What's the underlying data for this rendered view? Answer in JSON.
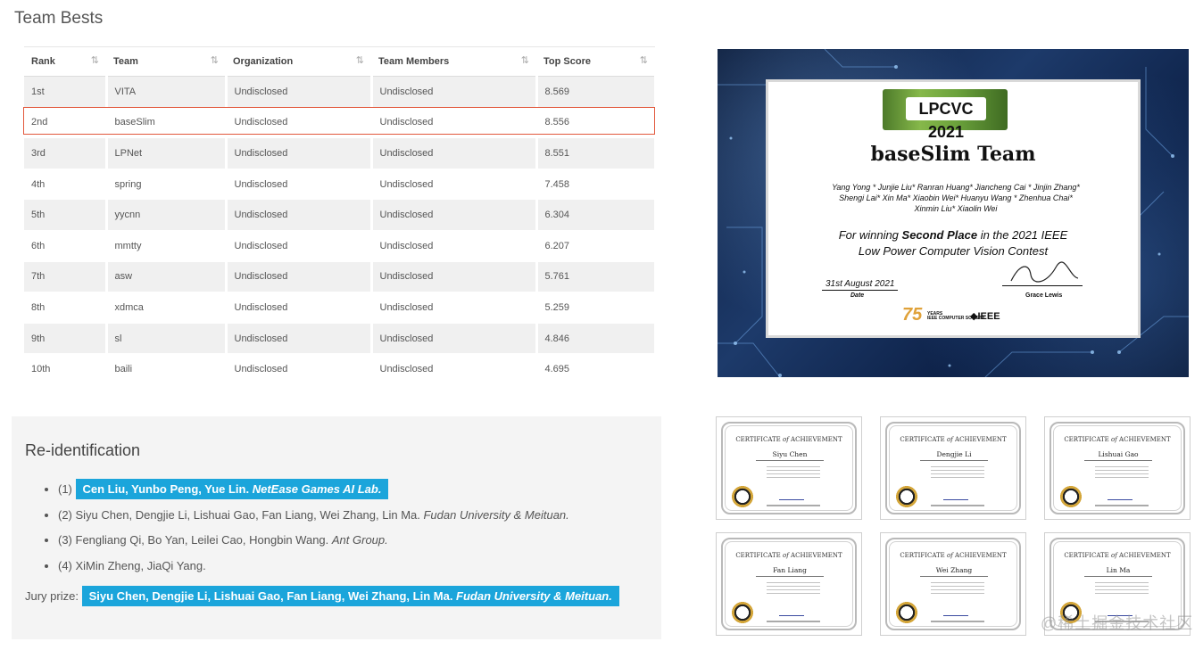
{
  "team_bests": {
    "title": "Team Bests",
    "columns": [
      "Rank",
      "Team",
      "Organization",
      "Team Members",
      "Top Score"
    ],
    "sort_icon": "⇅",
    "rows": [
      {
        "rank": "1st",
        "team": "VITA",
        "org": "Undisclosed",
        "members": "Undisclosed",
        "score": "8.569"
      },
      {
        "rank": "2nd",
        "team": "baseSlim",
        "org": "Undisclosed",
        "members": "Undisclosed",
        "score": "8.556"
      },
      {
        "rank": "3rd",
        "team": "LPNet",
        "org": "Undisclosed",
        "members": "Undisclosed",
        "score": "8.551"
      },
      {
        "rank": "4th",
        "team": "spring",
        "org": "Undisclosed",
        "members": "Undisclosed",
        "score": "7.458"
      },
      {
        "rank": "5th",
        "team": "yycnn",
        "org": "Undisclosed",
        "members": "Undisclosed",
        "score": "6.304"
      },
      {
        "rank": "6th",
        "team": "mmtty",
        "org": "Undisclosed",
        "members": "Undisclosed",
        "score": "6.207"
      },
      {
        "rank": "7th",
        "team": "asw",
        "org": "Undisclosed",
        "members": "Undisclosed",
        "score": "5.761"
      },
      {
        "rank": "8th",
        "team": "xdmca",
        "org": "Undisclosed",
        "members": "Undisclosed",
        "score": "5.259"
      },
      {
        "rank": "9th",
        "team": "sl",
        "org": "Undisclosed",
        "members": "Undisclosed",
        "score": "4.846"
      },
      {
        "rank": "10th",
        "team": "baili",
        "org": "Undisclosed",
        "members": "Undisclosed",
        "score": "4.695"
      }
    ],
    "highlight_color": "#e2583c"
  },
  "reid": {
    "title": "Re-identification",
    "items": [
      {
        "prefix": "(1) ",
        "highlight": "Cen Liu, Yunbo Peng, Yue Lin. ",
        "highlight_italic": "NetEase Games AI Lab.",
        "text": "",
        "italic": ""
      },
      {
        "prefix": "(2) ",
        "highlight": "",
        "highlight_italic": "",
        "text": "Siyu Chen, Dengjie Li, Lishuai Gao, Fan Liang, Wei Zhang, Lin Ma. ",
        "italic": "Fudan University & Meituan."
      },
      {
        "prefix": "(3) ",
        "highlight": "",
        "highlight_italic": "",
        "text": "Fengliang Qi, Bo Yan, Leilei Cao, Hongbin Wang. ",
        "italic": "Ant Group."
      },
      {
        "prefix": "(4) ",
        "highlight": "",
        "highlight_italic": "",
        "text": "XiMin Zheng, JiaQi Yang.",
        "italic": ""
      }
    ],
    "jury_label": "Jury prize: ",
    "jury_text": "Siyu Chen, Dengjie Li, Lishuai Gao, Fan Liang, Wei Zhang, Lin Ma. ",
    "jury_italic": "Fudan University & Meituan.",
    "highlight_color": "#1ba5db"
  },
  "certificate": {
    "logo": "LPCVC  2021",
    "team": "baseSlim Team",
    "members_line1": "Yang Yong * Junjie Liu* Ranran Huang* Jiancheng Cai * Jinjin Zhang*",
    "members_line2": "Shengi Lai* Xin Ma* Xiaobin Wei* Huanyu Wang * Zhenhua Chai*",
    "members_line3": "Xinmin Liu* Xiaolin Wei",
    "award_pre": "For winning ",
    "award_bold": "Second Place",
    "award_post": " in the 2021 IEEE",
    "award_line2": "Low Power Computer Vision Contest",
    "date": "31st August 2021",
    "date_label": "Date",
    "signer": "Grace Lewis",
    "seventyfive": "75",
    "years": "YEARS",
    "society": "IEEE COMPUTER SOCIETY",
    "ieee": "◆IEEE"
  },
  "small_certs": {
    "heading_pre": "CERTIFICATE ",
    "heading_of": "of",
    "heading_post": " ACHIEVEMENT",
    "names": [
      "Siyu Chen",
      "Dengjie Li",
      "Lishuai Gao",
      "Fan Liang",
      "Wei Zhang",
      "Lin Ma"
    ]
  },
  "watermark": "@稀土掘金技术社区"
}
